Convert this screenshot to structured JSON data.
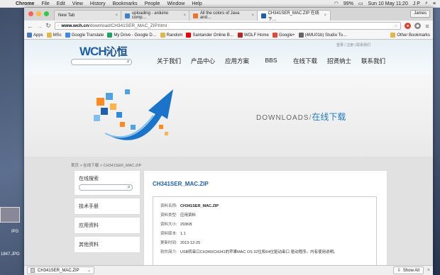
{
  "menubar": {
    "items": [
      "Chrome",
      "File",
      "Edit",
      "View",
      "History",
      "Bookmarks",
      "People",
      "Window",
      "Help"
    ],
    "battery": "99%",
    "clock": "Sun 10 May  11:20",
    "user_initials": "J P"
  },
  "desktop": {
    "file_label_1": "IPG",
    "file_label_2": "1847.JPG"
  },
  "tabs": [
    {
      "title": "New Tab",
      "close": "×"
    },
    {
      "title": "uploading - arduino comp…",
      "close": "×"
    },
    {
      "title": "All the colors of Java and…",
      "close": "×"
    },
    {
      "title": "CH341SER_MAC.ZIP 在线下…",
      "close": "×"
    }
  ],
  "profile_button": "James",
  "address_bar": {
    "host": "www.wch.cn",
    "path": "/download/CH341SER_MAC_ZIP.html"
  },
  "bookmarks": [
    "Apps",
    "MSc",
    "Google Translate",
    "My Drive - Google D…",
    "Random",
    "Santander Online B…",
    "WOLF Home",
    "Google+",
    "(4MU01b) Studio To…"
  ],
  "other_bookmarks": "Other Bookmarks",
  "site": {
    "logo_latin": "WCH",
    "logo_cn": "沁恒",
    "top_links": "登录 | 注册 | 联系我们",
    "nav": [
      "关于我们",
      "产品中心",
      "应用方案",
      "BBS",
      "在线下载",
      "招贤纳士",
      "联系我们"
    ],
    "banner_en": "DOWNLOADS",
    "banner_slash": "/",
    "banner_cn": "在线下载",
    "breadcrumb": "首页 > 在线下载 > CH341SER_MAC.ZIP",
    "sidebar": {
      "search_title": "在线搜索",
      "items": [
        "技术手册",
        "应用资料",
        "其他资料"
      ]
    },
    "file_title": "CH341SER_MAC.ZIP",
    "details": [
      {
        "key": "资料名称:",
        "value": "CH341SER_MAC.ZIP"
      },
      {
        "key": "资料类型:",
        "value": "应用资料"
      },
      {
        "key": "资料大小:",
        "value": "293KB"
      },
      {
        "key": "资料版本:",
        "value": "1.1"
      },
      {
        "key": "更新时间:",
        "value": "2013-12-25"
      },
      {
        "key": "软件简介:",
        "value": "USB转串口CH340/CH341的苹果MAC OS 32位和64位驱动串口 驱动程序。内有使用说明。"
      }
    ]
  },
  "download_bar": {
    "file": "CH341SER_MAC.ZIP",
    "chevron": "⌄",
    "show_all": "Show All",
    "close": "×"
  },
  "colors": {
    "brand_blue": "#1d5fa8",
    "banner_cn": "#1e7cbf"
  }
}
